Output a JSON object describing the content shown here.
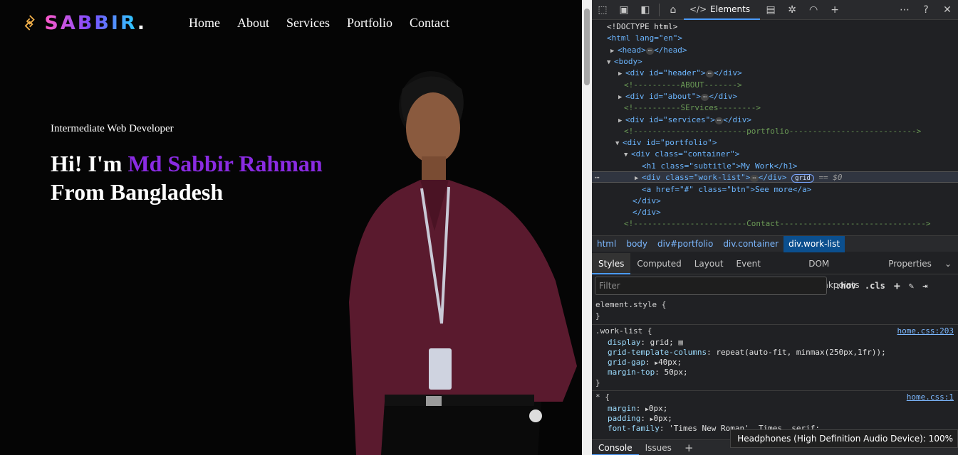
{
  "site": {
    "logo_text": "SABBIR",
    "logo_dot": ".",
    "nav": [
      "Home",
      "About",
      "Services",
      "Portfolio",
      "Contact"
    ],
    "hero": {
      "subtitle": "Intermediate Web Developer",
      "greeting": "Hi! I'm ",
      "name": "Md Sabbir Rahman",
      "line2": "From Bangladesh"
    },
    "accent_color": "#8a2be2"
  },
  "devtools": {
    "active_tab": "Elements",
    "dom_lines": [
      "<!DOCTYPE html>",
      "<html lang=\"en\">",
      "<head>",
      "</head>",
      "<body>",
      "<div id=\"header\">",
      "<!----------ABOUT------->",
      "<div id=\"about\">",
      "<!----------SErvices-------->",
      "<div id=\"services\">",
      "<!------------------------portfolio--------------------------->",
      "<div id=\"portfolio\">",
      "<div class=\"container\">",
      "<h1 class=\"subtitle\">My Work</h1>",
      "<div class=\"work-list\">",
      "</div>",
      "grid",
      "== $0",
      "<a href=\"#\" class=\"btn\">See more</a>",
      "</div>",
      "</div>",
      "<!------------------------Contact------------------------------->"
    ],
    "breadcrumbs": [
      "html",
      "body",
      "div#portfolio",
      "div.container",
      "div.work-list"
    ],
    "subtabs": [
      "Styles",
      "Computed",
      "Layout",
      "Event Listeners",
      "DOM Breakpoints",
      "Properties"
    ],
    "filter_placeholder": "Filter",
    "filter_buttons": [
      ":hov",
      ".cls"
    ],
    "styles": {
      "element_style": "element.style {",
      "close": "}",
      "rule1_selector": ".work-list {",
      "rule1_source": "home.css:203",
      "rule1_props": [
        {
          "name": "display",
          "value": "grid;"
        },
        {
          "name": "grid-template-columns",
          "value": "repeat(auto-fit, minmax(250px,1fr));"
        },
        {
          "name": "grid-gap",
          "value": "40px;"
        },
        {
          "name": "margin-top",
          "value": "50px;"
        }
      ],
      "rule2_selector": "* {",
      "rule2_source": "home.css:1",
      "rule2_props": [
        {
          "name": "margin",
          "value": "0px;"
        },
        {
          "name": "padding",
          "value": "0px;"
        },
        {
          "name": "font-family",
          "value": "'Times New Roman', Times, serif;"
        }
      ]
    },
    "drawer_tabs": [
      "Console",
      "Issues"
    ],
    "toast": "Headphones (High Definition Audio Device): 100%"
  }
}
